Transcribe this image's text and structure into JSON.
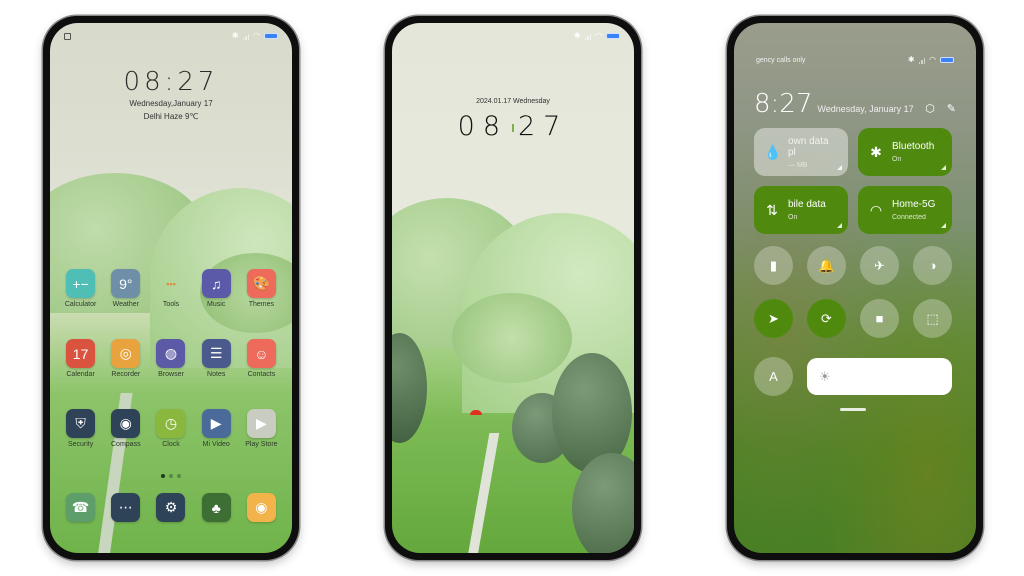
{
  "phones": {
    "home": {
      "status": {
        "left_icon": "screenshot-icon"
      },
      "clock": "08:27",
      "date": "Wednesday,January 17",
      "weather": "Delhi Haze 9℃",
      "apps_row1": [
        {
          "label": "Calculator",
          "icon": "calculator-icon",
          "color": "#4fbfb5",
          "glyph": "+−"
        },
        {
          "label": "Weather",
          "icon": "weather-icon",
          "color": "#6f8fa8",
          "glyph": "9°"
        },
        {
          "label": "Tools",
          "icon": "tools-icon",
          "color": "transparent",
          "glyph": "▪▪▪"
        },
        {
          "label": "Music",
          "icon": "music-icon",
          "color": "#5a5aa8",
          "glyph": "♫"
        },
        {
          "label": "Themes",
          "icon": "themes-icon",
          "color": "#ee6a5a",
          "glyph": "🎨"
        }
      ],
      "apps_row2": [
        {
          "label": "Calendar",
          "icon": "calendar-icon",
          "color": "#d9533f",
          "glyph": "17"
        },
        {
          "label": "Recorder",
          "icon": "recorder-icon",
          "color": "#e8a33e",
          "glyph": "◎"
        },
        {
          "label": "Browser",
          "icon": "browser-icon",
          "color": "#5c5aa6",
          "glyph": "◍"
        },
        {
          "label": "Notes",
          "icon": "notes-icon",
          "color": "#4a5a8c",
          "glyph": "☰"
        },
        {
          "label": "Contacts",
          "icon": "contacts-icon",
          "color": "#ee6a5a",
          "glyph": "☺"
        }
      ],
      "apps_row3": [
        {
          "label": "Security",
          "icon": "security-icon",
          "color": "#2f4358",
          "glyph": "⛨"
        },
        {
          "label": "Compass",
          "icon": "compass-icon",
          "color": "#2f4358",
          "glyph": "◉"
        },
        {
          "label": "Clock",
          "icon": "clock-icon",
          "color": "#8ab83f",
          "glyph": "◷"
        },
        {
          "label": "Mi Video",
          "icon": "mi-video-icon",
          "color": "#4a6a9a",
          "glyph": "▶"
        },
        {
          "label": "Play Store",
          "icon": "play-store-icon",
          "color": "#c9cdc1",
          "glyph": "▶"
        }
      ],
      "dock": [
        {
          "label": "Phone",
          "icon": "phone-icon",
          "color": "#5d9e6a",
          "glyph": "☎"
        },
        {
          "label": "Messages",
          "icon": "messages-icon",
          "color": "#2f4358",
          "glyph": "⋯"
        },
        {
          "label": "Settings",
          "icon": "settings-icon",
          "color": "#2f4358",
          "glyph": "⚙"
        },
        {
          "label": "Gallery",
          "icon": "gallery-icon",
          "color": "#3d6e34",
          "glyph": "♣"
        },
        {
          "label": "Camera",
          "icon": "camera-icon",
          "color": "#f2b34a",
          "glyph": "◉"
        }
      ],
      "page_count": 3,
      "current_page": 1
    },
    "lock": {
      "date": "2024.01.17 Wednesday",
      "clock_h": "08",
      "clock_m": "27"
    },
    "control_center": {
      "carrier": "gency calls only",
      "time": "8:27",
      "date": "Wednesday, January 17",
      "tiles": [
        {
          "title": "own data pl",
          "sub": "— MB",
          "icon": "water-drop-icon",
          "glyph": "💧",
          "active": false
        },
        {
          "title": "Bluetooth",
          "sub": "On",
          "icon": "bluetooth-icon",
          "glyph": "✱",
          "active": true
        },
        {
          "title": "bile data",
          "sub": "On",
          "icon": "mobile-data-icon",
          "glyph": "⇅",
          "active": true
        },
        {
          "title": "Home-5G",
          "sub": "Connected",
          "icon": "wifi-icon",
          "glyph": "◠",
          "active": true
        }
      ],
      "toggles": [
        {
          "name": "flashlight",
          "icon": "flashlight-icon",
          "glyph": "▮",
          "active": false
        },
        {
          "name": "mute",
          "icon": "bell-icon",
          "glyph": "🔔",
          "active": false
        },
        {
          "name": "airplane-mode",
          "icon": "airplane-icon",
          "glyph": "✈",
          "active": false
        },
        {
          "name": "dark-mode",
          "icon": "contrast-icon",
          "glyph": "◑",
          "active": false
        },
        {
          "name": "location",
          "icon": "location-arrow-icon",
          "glyph": "➤",
          "active": true
        },
        {
          "name": "rotation-lock",
          "icon": "rotation-lock-icon",
          "glyph": "⟳",
          "active": true
        },
        {
          "name": "screen-record",
          "icon": "video-camera-icon",
          "glyph": "■",
          "active": false
        },
        {
          "name": "scan",
          "icon": "scan-icon",
          "glyph": "⬚",
          "active": false
        },
        {
          "name": "auto-brightness",
          "icon": "auto-brightness-icon",
          "glyph": "A",
          "active": false
        }
      ],
      "brightness_glyph": "☀",
      "brightness_level": 0.0
    }
  }
}
